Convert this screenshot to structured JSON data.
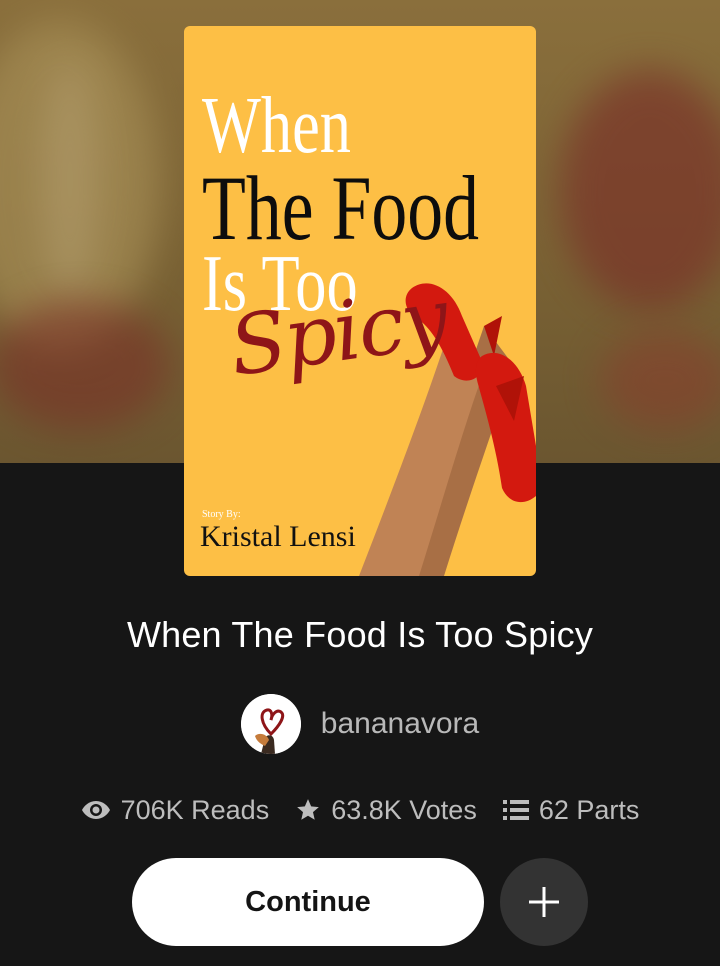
{
  "cover": {
    "line1": "When",
    "line2": "The Food",
    "line3": "Is Too",
    "script": "Spicy",
    "story_by": "Story By:",
    "author": "Kristal Lensi",
    "colors": {
      "background": "#fdbf45",
      "script": "#8e1518",
      "shoe": "#d3190f"
    }
  },
  "story": {
    "title": "When The Food Is Too Spicy",
    "author": "bananavora"
  },
  "stats": {
    "reads": "706K Reads",
    "votes": "63.8K Votes",
    "parts": "62 Parts",
    "icons": [
      "eye-icon",
      "star-icon",
      "list-icon"
    ]
  },
  "actions": {
    "continue_label": "Continue",
    "add_icon": "plus-icon"
  }
}
